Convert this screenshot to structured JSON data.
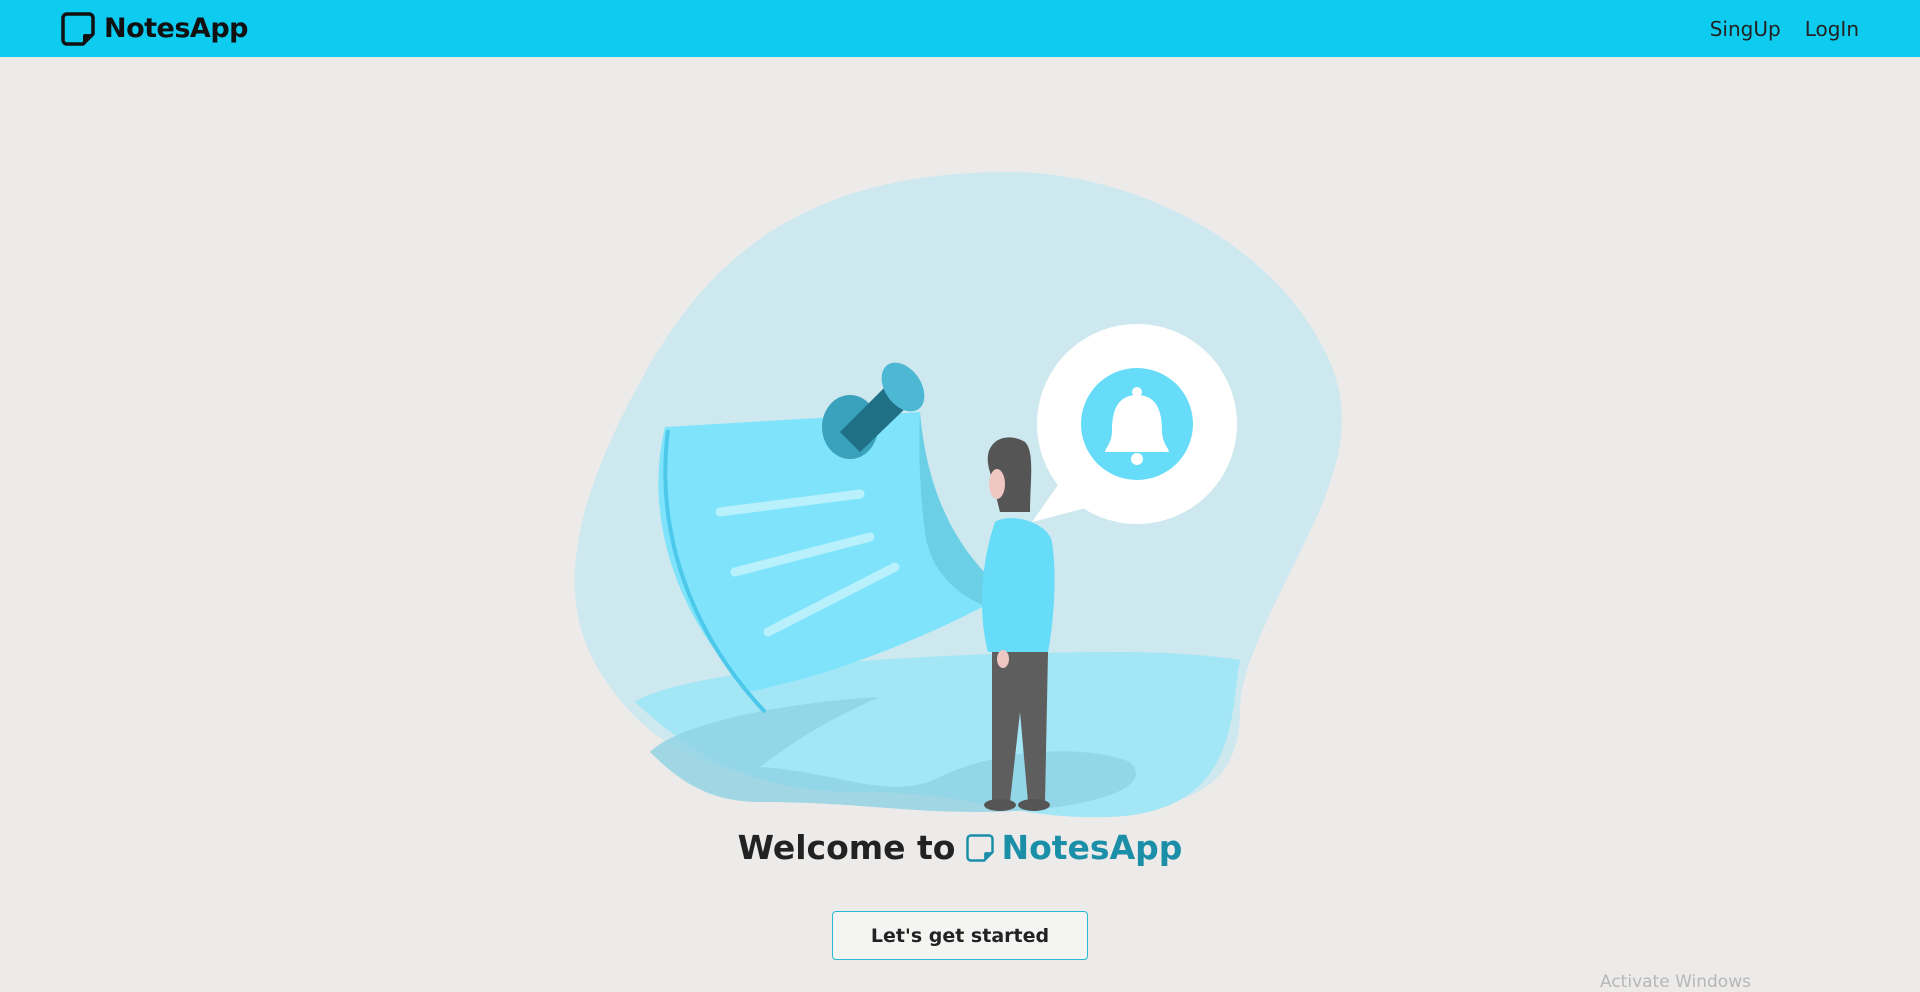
{
  "navbar": {
    "brand": "NotesApp",
    "links": [
      "SingUp",
      "LogIn"
    ]
  },
  "hero": {
    "welcome_prefix": "Welcome to",
    "welcome_brand": "NotesApp",
    "cta_label": "Let's get started"
  },
  "watermark": "Activate Windows",
  "colors": {
    "navbar": "#0ecbf0",
    "background": "#ecebea",
    "brand_accent": "#1b8fa8",
    "illustration_light": "#cde8ef",
    "illustration_cyan": "#66dcf9"
  },
  "icons": [
    "note-icon",
    "pushpin-icon",
    "bell-icon",
    "person-icon"
  ]
}
